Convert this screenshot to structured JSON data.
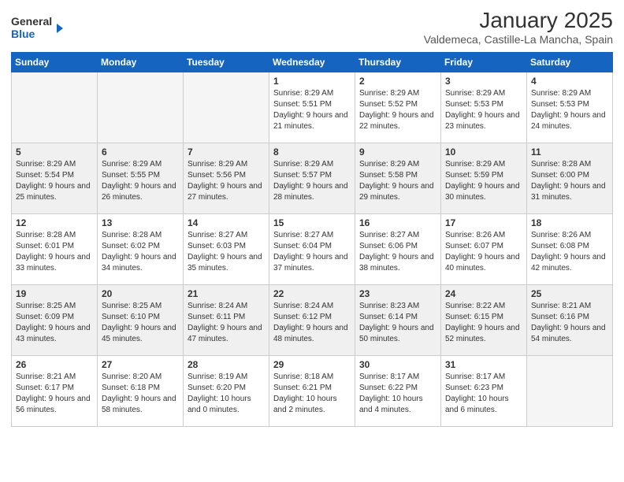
{
  "logo": {
    "line1": "General",
    "line2": "Blue"
  },
  "title": {
    "month_year": "January 2025",
    "location": "Valdemeca, Castille-La Mancha, Spain"
  },
  "weekdays": [
    "Sunday",
    "Monday",
    "Tuesday",
    "Wednesday",
    "Thursday",
    "Friday",
    "Saturday"
  ],
  "weeks": [
    {
      "alt": false,
      "days": [
        {
          "num": "",
          "info": ""
        },
        {
          "num": "",
          "info": ""
        },
        {
          "num": "",
          "info": ""
        },
        {
          "num": "1",
          "info": "Sunrise: 8:29 AM\nSunset: 5:51 PM\nDaylight: 9 hours and 21 minutes."
        },
        {
          "num": "2",
          "info": "Sunrise: 8:29 AM\nSunset: 5:52 PM\nDaylight: 9 hours and 22 minutes."
        },
        {
          "num": "3",
          "info": "Sunrise: 8:29 AM\nSunset: 5:53 PM\nDaylight: 9 hours and 23 minutes."
        },
        {
          "num": "4",
          "info": "Sunrise: 8:29 AM\nSunset: 5:53 PM\nDaylight: 9 hours and 24 minutes."
        }
      ]
    },
    {
      "alt": true,
      "days": [
        {
          "num": "5",
          "info": "Sunrise: 8:29 AM\nSunset: 5:54 PM\nDaylight: 9 hours and 25 minutes."
        },
        {
          "num": "6",
          "info": "Sunrise: 8:29 AM\nSunset: 5:55 PM\nDaylight: 9 hours and 26 minutes."
        },
        {
          "num": "7",
          "info": "Sunrise: 8:29 AM\nSunset: 5:56 PM\nDaylight: 9 hours and 27 minutes."
        },
        {
          "num": "8",
          "info": "Sunrise: 8:29 AM\nSunset: 5:57 PM\nDaylight: 9 hours and 28 minutes."
        },
        {
          "num": "9",
          "info": "Sunrise: 8:29 AM\nSunset: 5:58 PM\nDaylight: 9 hours and 29 minutes."
        },
        {
          "num": "10",
          "info": "Sunrise: 8:29 AM\nSunset: 5:59 PM\nDaylight: 9 hours and 30 minutes."
        },
        {
          "num": "11",
          "info": "Sunrise: 8:28 AM\nSunset: 6:00 PM\nDaylight: 9 hours and 31 minutes."
        }
      ]
    },
    {
      "alt": false,
      "days": [
        {
          "num": "12",
          "info": "Sunrise: 8:28 AM\nSunset: 6:01 PM\nDaylight: 9 hours and 33 minutes."
        },
        {
          "num": "13",
          "info": "Sunrise: 8:28 AM\nSunset: 6:02 PM\nDaylight: 9 hours and 34 minutes."
        },
        {
          "num": "14",
          "info": "Sunrise: 8:27 AM\nSunset: 6:03 PM\nDaylight: 9 hours and 35 minutes."
        },
        {
          "num": "15",
          "info": "Sunrise: 8:27 AM\nSunset: 6:04 PM\nDaylight: 9 hours and 37 minutes."
        },
        {
          "num": "16",
          "info": "Sunrise: 8:27 AM\nSunset: 6:06 PM\nDaylight: 9 hours and 38 minutes."
        },
        {
          "num": "17",
          "info": "Sunrise: 8:26 AM\nSunset: 6:07 PM\nDaylight: 9 hours and 40 minutes."
        },
        {
          "num": "18",
          "info": "Sunrise: 8:26 AM\nSunset: 6:08 PM\nDaylight: 9 hours and 42 minutes."
        }
      ]
    },
    {
      "alt": true,
      "days": [
        {
          "num": "19",
          "info": "Sunrise: 8:25 AM\nSunset: 6:09 PM\nDaylight: 9 hours and 43 minutes."
        },
        {
          "num": "20",
          "info": "Sunrise: 8:25 AM\nSunset: 6:10 PM\nDaylight: 9 hours and 45 minutes."
        },
        {
          "num": "21",
          "info": "Sunrise: 8:24 AM\nSunset: 6:11 PM\nDaylight: 9 hours and 47 minutes."
        },
        {
          "num": "22",
          "info": "Sunrise: 8:24 AM\nSunset: 6:12 PM\nDaylight: 9 hours and 48 minutes."
        },
        {
          "num": "23",
          "info": "Sunrise: 8:23 AM\nSunset: 6:14 PM\nDaylight: 9 hours and 50 minutes."
        },
        {
          "num": "24",
          "info": "Sunrise: 8:22 AM\nSunset: 6:15 PM\nDaylight: 9 hours and 52 minutes."
        },
        {
          "num": "25",
          "info": "Sunrise: 8:21 AM\nSunset: 6:16 PM\nDaylight: 9 hours and 54 minutes."
        }
      ]
    },
    {
      "alt": false,
      "days": [
        {
          "num": "26",
          "info": "Sunrise: 8:21 AM\nSunset: 6:17 PM\nDaylight: 9 hours and 56 minutes."
        },
        {
          "num": "27",
          "info": "Sunrise: 8:20 AM\nSunset: 6:18 PM\nDaylight: 9 hours and 58 minutes."
        },
        {
          "num": "28",
          "info": "Sunrise: 8:19 AM\nSunset: 6:20 PM\nDaylight: 10 hours and 0 minutes."
        },
        {
          "num": "29",
          "info": "Sunrise: 8:18 AM\nSunset: 6:21 PM\nDaylight: 10 hours and 2 minutes."
        },
        {
          "num": "30",
          "info": "Sunrise: 8:17 AM\nSunset: 6:22 PM\nDaylight: 10 hours and 4 minutes."
        },
        {
          "num": "31",
          "info": "Sunrise: 8:17 AM\nSunset: 6:23 PM\nDaylight: 10 hours and 6 minutes."
        },
        {
          "num": "",
          "info": ""
        }
      ]
    }
  ]
}
